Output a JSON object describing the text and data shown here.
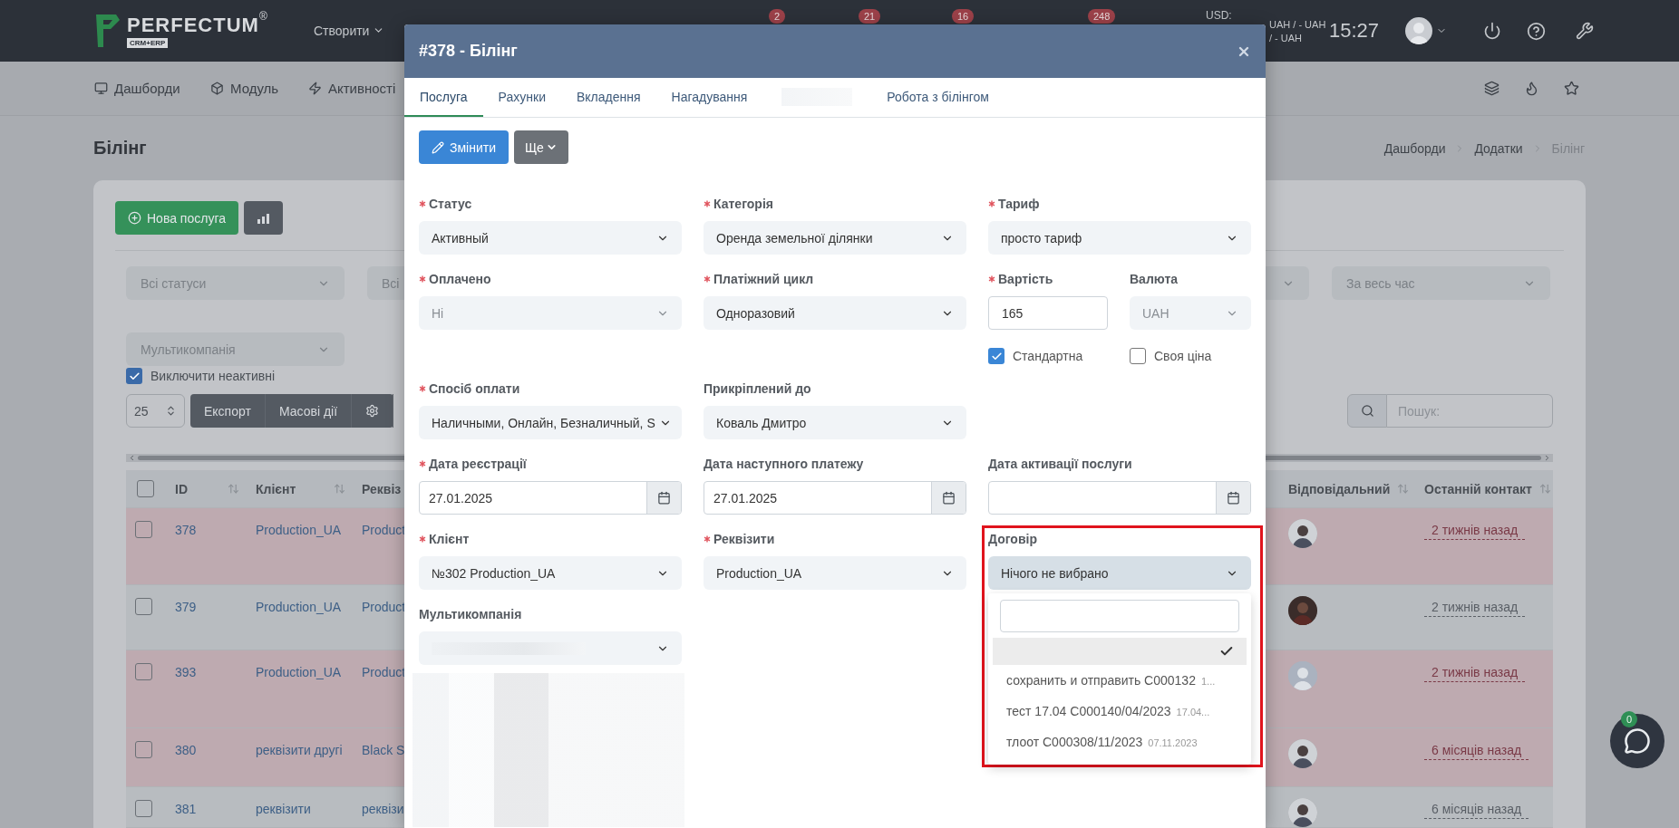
{
  "header": {
    "logo": "PERFECTUM",
    "logo_mark": "®",
    "logo_sub": "CRM+ERP",
    "create_menu": "Створити",
    "badges": [
      "2",
      "21",
      "16",
      "248"
    ],
    "currency_label": "USD:",
    "currency_lines": [
      "UAH / - UAH",
      "/ - UAH"
    ],
    "time": "15:27"
  },
  "nav": {
    "items": [
      "Дашборди",
      "Модуль",
      "Активності"
    ]
  },
  "page": {
    "title": "Білінг",
    "breadcrumbs": [
      {
        "label": "Дашборди",
        "current": false
      },
      {
        "label": "Додатки",
        "current": false
      },
      {
        "label": "Білінг",
        "current": true
      }
    ]
  },
  "toolbar": {
    "new_button": "Нова послуга"
  },
  "filters": {
    "left": [
      "Всі статуси",
      "Всі"
    ],
    "right": "За весь час",
    "multicompany": "Мультикомпанія"
  },
  "exclude_inactive": {
    "label": "Виключити неактивні",
    "checked": true
  },
  "page_size": "25",
  "actions": [
    "Експорт",
    "Масові дії"
  ],
  "search": {
    "placeholder": "Пошук:"
  },
  "table": {
    "select_all_checked": false,
    "columns_left": [
      "ID",
      "Клієнт",
      "Реквіз"
    ],
    "columns_right": [
      "Відповідальний",
      "Останній контакт"
    ],
    "rows": [
      {
        "id": "378",
        "client": "Production_UA",
        "requisites": "Product",
        "highlighted": true,
        "checked": false,
        "avatar": {
          "kind": "photo"
        },
        "last_contact": "2 тижнів назад"
      },
      {
        "id": "379",
        "client": "Production_UA",
        "requisites": "Product",
        "highlighted": false,
        "checked": false,
        "avatar": {
          "kind": "photo"
        },
        "last_contact": "2 тижнів назад"
      },
      {
        "id": "393",
        "client": "Production_UA",
        "requisites": "Product",
        "highlighted": true,
        "checked": false,
        "avatar": {
          "kind": "placeholder"
        },
        "last_contact": "2 тижнів назад"
      },
      {
        "id": "380",
        "client": "реквізити другі",
        "requisites": "Black S",
        "highlighted": true,
        "checked": false,
        "avatar": {
          "kind": "photo"
        },
        "last_contact": "6 місяців назад"
      },
      {
        "id": "381",
        "client": "реквізити",
        "requisites": "реквізи",
        "highlighted": false,
        "checked": false,
        "avatar": {
          "kind": "photo"
        },
        "last_contact": "6 місяців назад"
      }
    ]
  },
  "chat": {
    "badge": "0"
  },
  "modal": {
    "title": "#378 - Білінг",
    "tabs": [
      {
        "label": "Послуга",
        "selected": true
      },
      {
        "label": "Рахунки",
        "selected": false
      },
      {
        "label": "Вкладення",
        "selected": false
      },
      {
        "label": "Нагадування",
        "selected": false
      },
      {
        "kind": "blurred",
        "selected": false
      },
      {
        "label": "Робота з білінгом",
        "selected": false
      }
    ],
    "actions": {
      "edit": "Змінити",
      "more": "Ще"
    },
    "rows": [
      [
        {
          "label": "Статус",
          "required": true,
          "kind": "select",
          "value": "Активный"
        },
        {
          "label": "Категорія",
          "required": true,
          "kind": "select",
          "value": "Оренда земельної ділянки"
        },
        {
          "label": "Тариф",
          "required": true,
          "kind": "select",
          "value": "просто тариф"
        }
      ],
      [
        {
          "label": "Оплачено",
          "required": true,
          "kind": "select",
          "value": "Ні",
          "disabled": true
        },
        {
          "label": "Платіжний цикл",
          "required": true,
          "kind": "select",
          "value": "Одноразовий"
        },
        {
          "kind": "group",
          "parts": [
            {
              "label": "Вартість",
              "required": true,
              "kind": "input",
              "value": "165"
            },
            {
              "label": "Валюта",
              "required": false,
              "kind": "select",
              "value": "UAH",
              "disabled": true
            }
          ],
          "checkboxes": [
            {
              "label": "Стандартна",
              "checked": true
            },
            {
              "label": "Своя ціна",
              "checked": false
            }
          ]
        }
      ],
      [
        {
          "label": "Спосіб оплати",
          "required": true,
          "kind": "select",
          "value": "Наличными, Онлайн, Безналичный, S"
        },
        {
          "label": "Прикріплений до",
          "required": false,
          "kind": "select",
          "value": "Коваль Дмитро"
        }
      ],
      [
        {
          "label": "Дата реєстрації",
          "required": true,
          "kind": "date",
          "value": "27.01.2025"
        },
        {
          "label": "Дата наступного платежу",
          "required": false,
          "kind": "date",
          "value": "27.01.2025"
        },
        {
          "label": "Дата активації послуги",
          "required": false,
          "kind": "date"
        }
      ],
      [
        {
          "label": "Клієнт",
          "required": true,
          "kind": "select",
          "value": "№302 Production_UA"
        },
        {
          "label": "Реквізити",
          "required": true,
          "kind": "select",
          "value": "Production_UA"
        },
        {
          "label": "Договір",
          "required": false,
          "kind": "select",
          "value": "Нічого не вибрано",
          "open": true,
          "highlighted": true,
          "options": [
            {
              "selected": true
            },
            {
              "label": "сохранить и отправить С000132",
              "note": "1...",
              "selected": false
            },
            {
              "label": "тест 17.04 С000140/04/2023",
              "note": "17.04...",
              "selected": false
            },
            {
              "label": "тлоот С000308/11/2023",
              "note": "07.11.2023",
              "selected": false
            }
          ]
        }
      ],
      [
        {
          "label": "Мультикомпанія",
          "required": false,
          "kind": "select",
          "blurred": true
        }
      ]
    ],
    "blurred_block": true
  }
}
